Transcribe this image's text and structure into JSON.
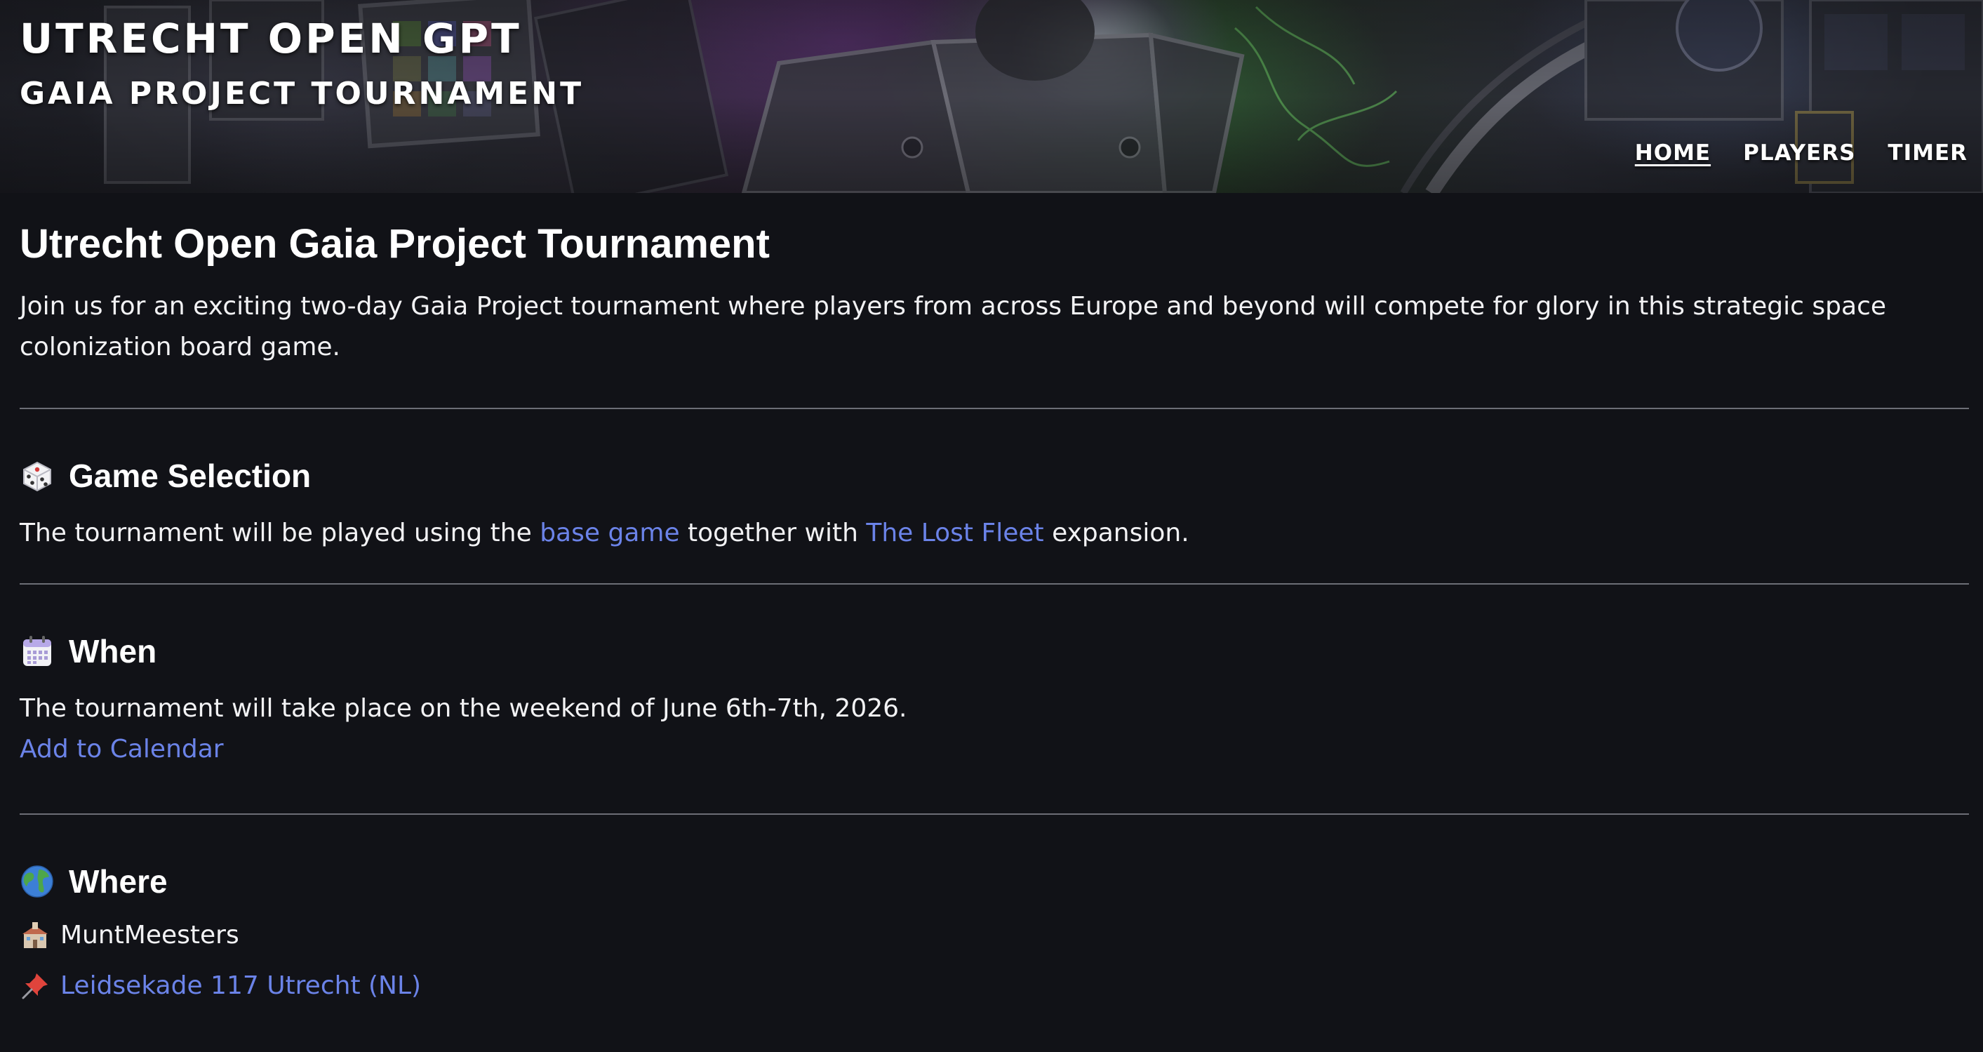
{
  "header": {
    "site_title": "UTRECHT OPEN GPT",
    "site_subtitle": "GAIA PROJECT TOURNAMENT",
    "nav": [
      {
        "label": "HOME",
        "active": true
      },
      {
        "label": "PLAYERS",
        "active": false
      },
      {
        "label": "TIMER",
        "active": false
      }
    ]
  },
  "main": {
    "title": "Utrecht Open Gaia Project Tournament",
    "intro": "Join us for an exciting two-day Gaia Project tournament where players from across Europe and beyond will compete for glory in this strategic space colonization board game.",
    "game_selection": {
      "icon": "dice-icon",
      "heading": "Game Selection",
      "text_before": "The tournament will be played using the ",
      "link1": "base game",
      "text_middle": " together with ",
      "link2": "The Lost Fleet",
      "text_after": " expansion."
    },
    "when": {
      "icon": "calendar-icon",
      "heading": "When",
      "text": "The tournament will take place on the weekend of June 6th-7th, 2026.",
      "calendar_link": "Add to Calendar"
    },
    "where": {
      "icon": "globe-icon",
      "heading": "Where",
      "venue_icon": "building-icon",
      "venue": "MuntMeesters",
      "address_icon": "pushpin-icon",
      "address": "Leidsekade 117 Utrecht (NL)"
    }
  },
  "colors": {
    "background": "#111217",
    "link": "#6b83e8",
    "divider": "#6c6e76",
    "text": "#ffffff"
  }
}
